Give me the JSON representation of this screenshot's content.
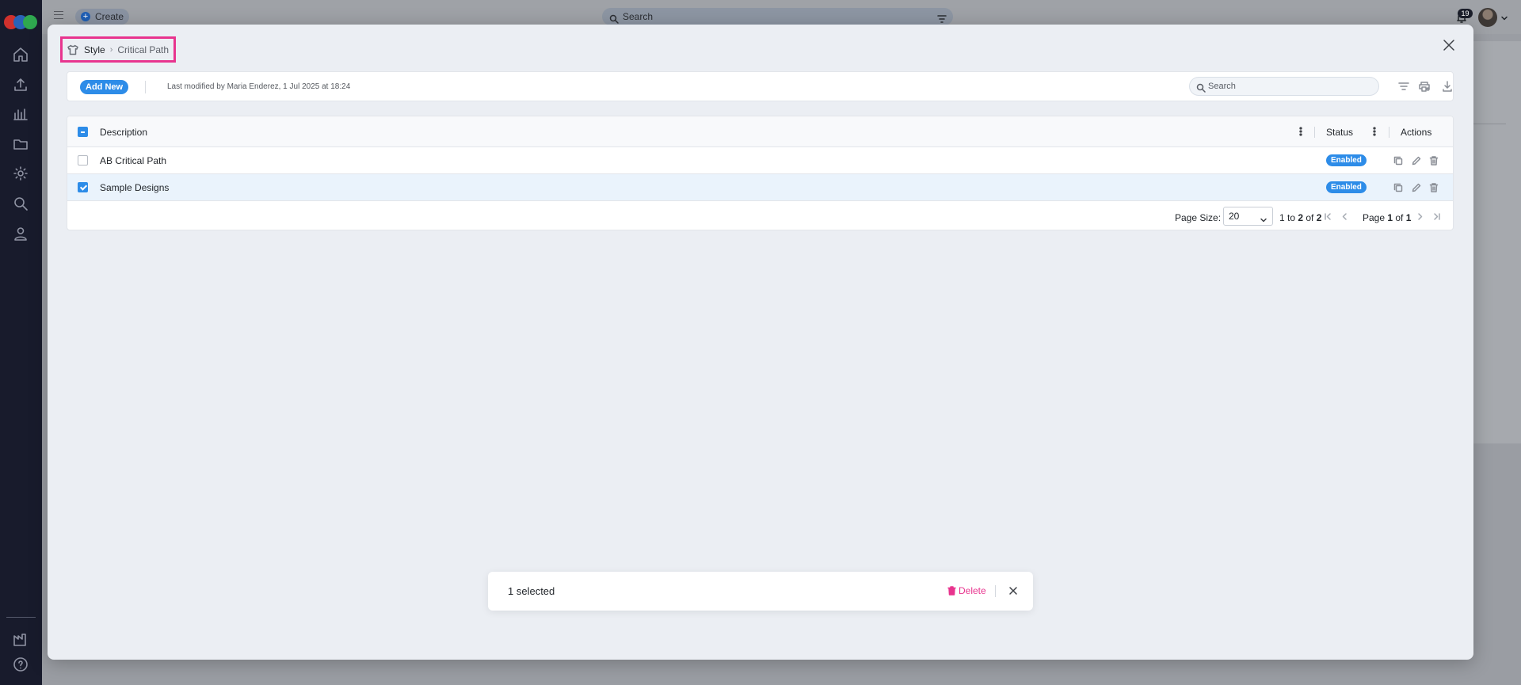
{
  "app": {
    "create_label": "Create",
    "search_placeholder": "Search",
    "notification_count": "19"
  },
  "sidebar": {
    "items": [
      {
        "name": "home-icon"
      },
      {
        "name": "upload-icon"
      },
      {
        "name": "chart-icon"
      },
      {
        "name": "folder-icon"
      },
      {
        "name": "gear-icon"
      },
      {
        "name": "search-icon"
      },
      {
        "name": "user-icon"
      },
      {
        "name": "factory-icon"
      },
      {
        "name": "help-icon"
      }
    ]
  },
  "modal": {
    "breadcrumb": {
      "root": "Style",
      "current": "Critical Path"
    },
    "toolbar": {
      "add_new_label": "Add New",
      "last_modified": "Last modified by Maria Enderez, 1 Jul 2025 at 18:24",
      "search_placeholder": "Search"
    },
    "table": {
      "columns": [
        "Description",
        "Status",
        "Actions"
      ],
      "rows": [
        {
          "description": "AB Critical Path",
          "status": "Enabled",
          "selected": false
        },
        {
          "description": "Sample Designs",
          "status": "Enabled",
          "selected": true
        }
      ],
      "status_color": "#2d8ce8"
    },
    "pagination": {
      "page_size_label": "Page Size:",
      "page_size": "20",
      "range_prefix": "1 to ",
      "range_end": "2",
      "range_of": " of ",
      "range_total": "2",
      "page_prefix": "Page ",
      "page_current": "1",
      "page_of": " of ",
      "page_total": "1"
    },
    "selection": {
      "count_label": "1 selected",
      "delete_label": "Delete",
      "delete_color": "#e8348e"
    }
  },
  "colors": {
    "accent": "#2d8ce8",
    "highlight": "#e8348e",
    "sidebar_bg": "#181b2c"
  }
}
